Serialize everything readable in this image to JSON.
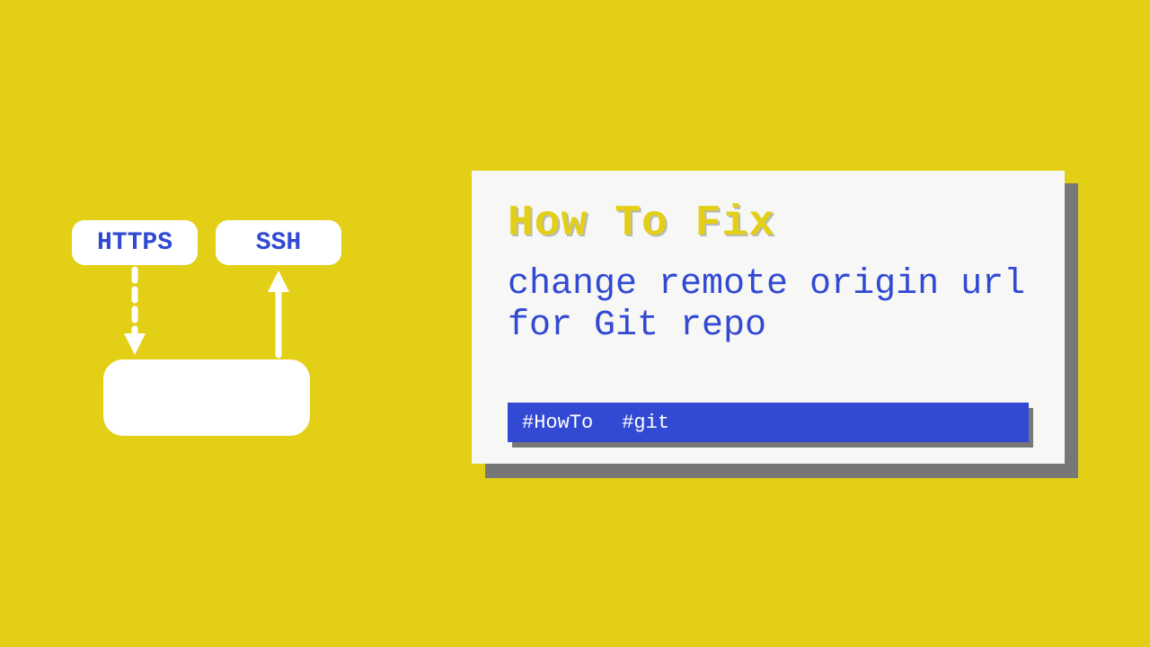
{
  "diagram": {
    "node_https": "HTTPS",
    "node_ssh": "SSH"
  },
  "card": {
    "title": "How To Fix",
    "subtitle": "change remote origin url for Git repo",
    "tags": [
      "#HowTo",
      "#git"
    ]
  }
}
